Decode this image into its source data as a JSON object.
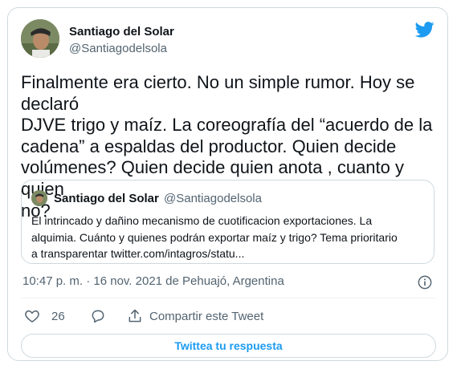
{
  "tweet": {
    "author_name": "Santiago del Solar",
    "author_handle": "@Santiagodelsola",
    "text": "Finalmente era cierto. No un simple rumor. Hoy se declaró\nDJVE trigo y maíz. La coreografía del “acuerdo de la\ncadena” a espaldas del productor. Quien decide\nvolúmenes? Quien decide quien anota , cuanto y quien\nno?",
    "timestamp": "10:47 p. m. · 16 nov. 2021 de Pehuajó, Argentina",
    "like_count": "26",
    "share_label": "Compartir este Tweet",
    "reply_button_label": "Twittea tu respuesta"
  },
  "quoted_tweet": {
    "author_name": "Santiago del Solar",
    "author_handle": "@Santiagodelsola",
    "text": "El intrincado y dañino mecanismo de cuotificacion exportaciones. La\nalquimia. Cuánto y quienes podrán exportar maíz y trigo? Tema prioritario\na transparentar twitter.com/intagros/statu..."
  },
  "icons": {
    "brand": "twitter-bird-icon",
    "info": "info-icon",
    "like": "heart-icon",
    "reply": "comment-icon",
    "share": "share-icon"
  },
  "colors": {
    "brand_blue": "#1d9bf0",
    "secondary_text": "#536471",
    "border": "#cfd9de"
  }
}
